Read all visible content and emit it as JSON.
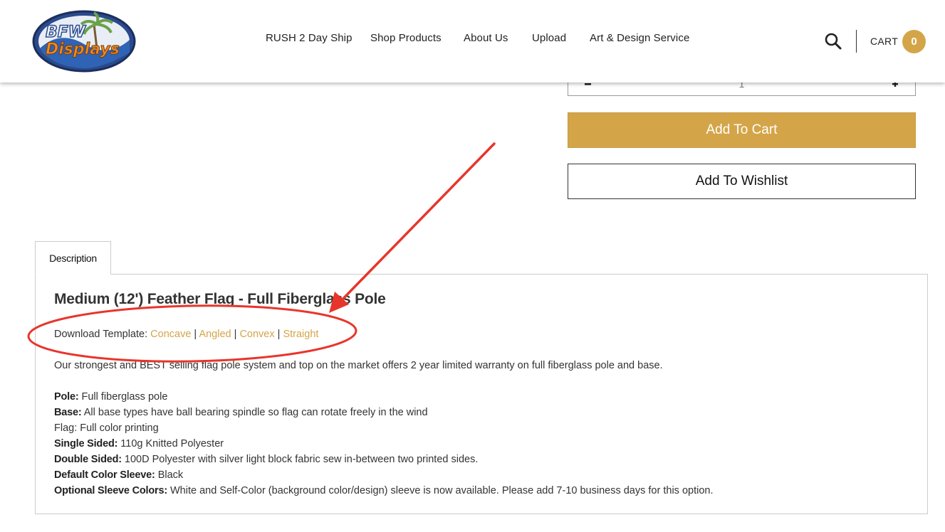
{
  "header": {
    "logo": {
      "line1": "BFW",
      "line2": "Displays"
    },
    "nav": [
      {
        "label": "RUSH 2 Day Ship"
      },
      {
        "label": "Shop Products"
      },
      {
        "label": "About Us"
      },
      {
        "label": "Upload"
      },
      {
        "label": "Art & Design Service"
      }
    ],
    "search_icon": "search-icon",
    "cart_label": "CART",
    "cart_count": "0"
  },
  "purchase": {
    "quantity": "1",
    "minus_label": "-",
    "plus_label": "+",
    "add_to_cart_label": "Add To Cart",
    "add_to_wishlist_label": "Add To Wishlist"
  },
  "tabs": [
    {
      "label": "Description",
      "active": true
    }
  ],
  "description": {
    "title": "Medium (12') Feather Flag - Full Fiberglass Pole",
    "template_label": "Download Template:",
    "templates": [
      "Concave",
      "Angled",
      "Convex",
      "Straight"
    ],
    "separator": "|",
    "intro": "Our strongest and BEST selling flag pole system and top on the market offers 2 year limited warranty on full fiberglass pole and base.",
    "specs": [
      {
        "key": "Pole:",
        "value": "Full fiberglass pole"
      },
      {
        "key": "Base:",
        "value": "All base types have ball bearing spindle so flag can rotate freely in the wind"
      },
      {
        "key": "",
        "value": "Flag: Full color printing"
      },
      {
        "key": "Single Sided:",
        "value": "110g Knitted Polyester"
      },
      {
        "key": "Double Sided:",
        "value": "100D Polyester with silver light block fabric sew in-between two printed sides."
      },
      {
        "key": "Default Color Sleeve:",
        "value": "Black"
      },
      {
        "key": "Optional Sleeve Colors:",
        "value": "White and Self-Color (background color/design) sleeve is now available. Please add 7-10 business days for this option."
      }
    ]
  },
  "annotation": {
    "color": "#e8352b",
    "shape": "red-ellipse-and-arrow"
  },
  "colors": {
    "accent": "#d4a548",
    "text": "#333333",
    "border": "#cccccc"
  }
}
